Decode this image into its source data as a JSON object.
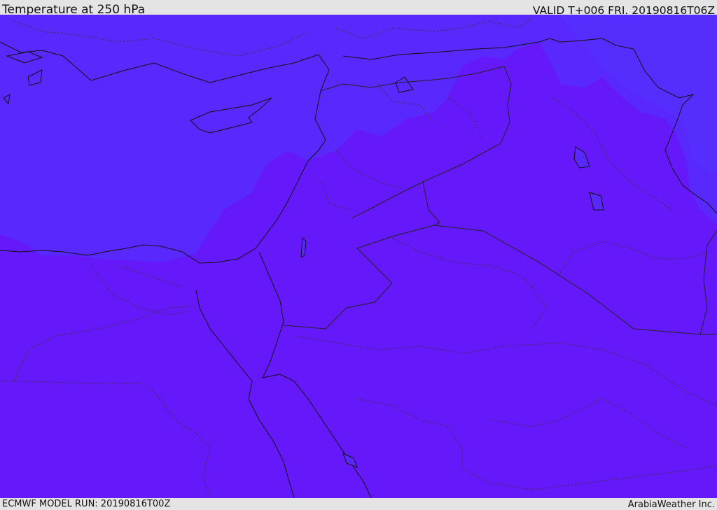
{
  "header": {
    "title": "Temperature at 250 hPa",
    "valid": "VALID T+006 FRI. 20190816T06Z"
  },
  "footer": {
    "model_run": "ECMWF MODEL RUN: 20190816T00Z",
    "credit": "ArabiaWeather Inc."
  },
  "colors": {
    "warm_band": "#6519fa",
    "cool_band": "#5828fc",
    "coastline": "#111111",
    "border": "#333333"
  }
}
